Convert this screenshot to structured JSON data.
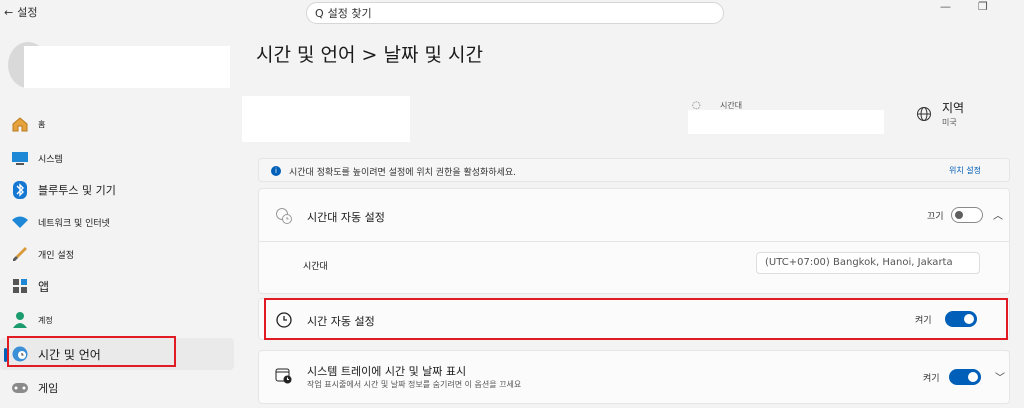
{
  "titlebar": {
    "back_label": "설정",
    "search_placeholder": "설정 찾기"
  },
  "sidebar": {
    "items": [
      {
        "label": "홈"
      },
      {
        "label": "시스템"
      },
      {
        "label": "블루투스 및 기기"
      },
      {
        "label": "네트워크 및 인터넷"
      },
      {
        "label": "개인 설정"
      },
      {
        "label": "앱"
      },
      {
        "label": "계정"
      },
      {
        "label": "시간 및 언어"
      },
      {
        "label": "게임"
      }
    ]
  },
  "main": {
    "title": "시간 및 언어 > 날짜 및 시간",
    "timezone_label": "시간대",
    "region_title": "지역",
    "region_value": "미국",
    "info_text": "시간대 정확도를 높이려면 설정에 위치 권한을 활성화하세요.",
    "info_link": "위치 설정",
    "auto_timezone_label": "시간대 자동 설정",
    "auto_timezone_state": "끄기",
    "timezone_row_label": "시간대",
    "timezone_value": "(UTC+07:00) Bangkok, Hanoi, Jakarta",
    "auto_time_label": "시간 자동 설정",
    "auto_time_state": "켜기",
    "tray_label": "시스템 트레이에 시간 및 날짜 표시",
    "tray_sub": "작업 표시줄에서 시간 및 날짜 정보를 숨기려면 이 옵션을 끄세요",
    "tray_state": "켜기"
  },
  "colors": {
    "accent": "#005fb8",
    "highlight": "#e01b24"
  }
}
